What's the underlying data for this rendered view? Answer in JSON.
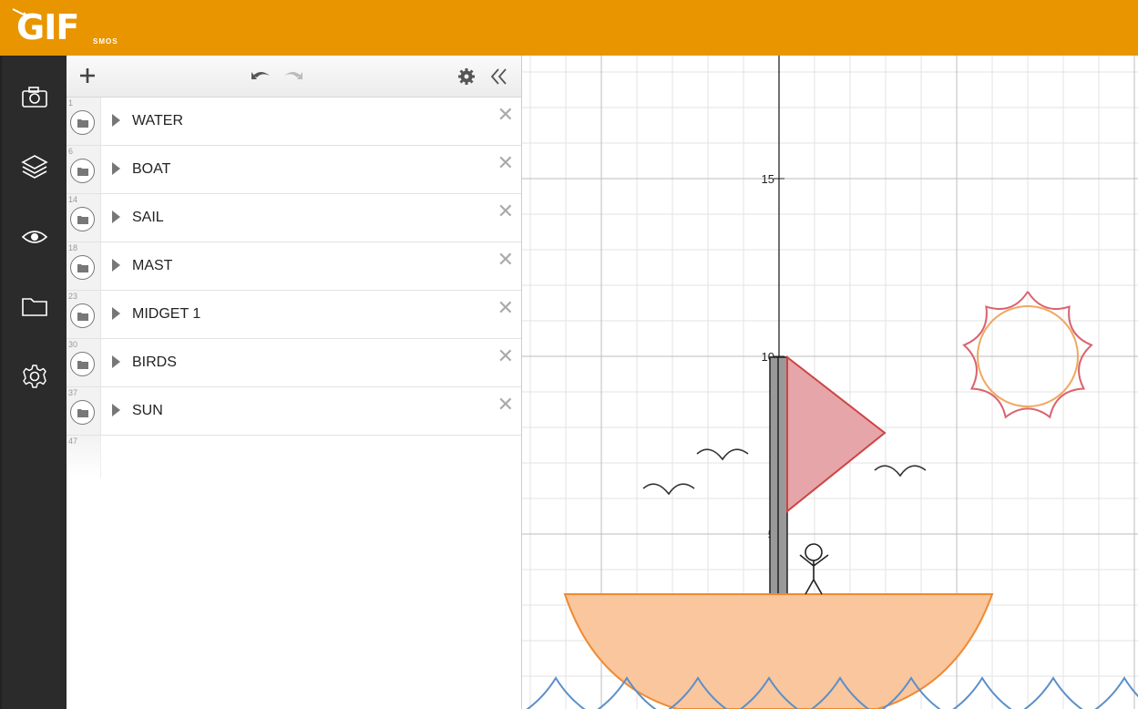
{
  "header": {
    "logo_text": "GIF",
    "logo_subtext": "SMOS",
    "color": "#e89500"
  },
  "sidenav": {
    "items": [
      {
        "icon": "camera-icon"
      },
      {
        "icon": "layers-icon"
      },
      {
        "icon": "eye-icon"
      },
      {
        "icon": "folder-icon"
      },
      {
        "icon": "gear-icon"
      }
    ]
  },
  "toolbar": {
    "add_icon": "plus-icon",
    "undo_icon": "undo-icon",
    "redo_icon": "redo-icon",
    "settings_icon": "gear-icon",
    "collapse_icon": "double-chevron-left-icon"
  },
  "folders": [
    {
      "index": "1",
      "label": "WATER"
    },
    {
      "index": "6",
      "label": "BOAT"
    },
    {
      "index": "14",
      "label": "SAIL"
    },
    {
      "index": "18",
      "label": "MAST"
    },
    {
      "index": "23",
      "label": "MIDGET 1"
    },
    {
      "index": "30",
      "label": "BIRDS"
    },
    {
      "index": "37",
      "label": "SUN"
    }
  ],
  "empty_row_index": "47",
  "graph": {
    "y_tick_labels": [
      "15",
      "10",
      "5"
    ],
    "colors": {
      "boat": "#f5a26b",
      "boat_stroke": "#f08a33",
      "sail": "#e6a5a8",
      "sail_stroke": "#cc4444",
      "mast": "#999999",
      "water": "#5b8fc9",
      "sun": "#d9636e",
      "birds": "#333333"
    }
  }
}
